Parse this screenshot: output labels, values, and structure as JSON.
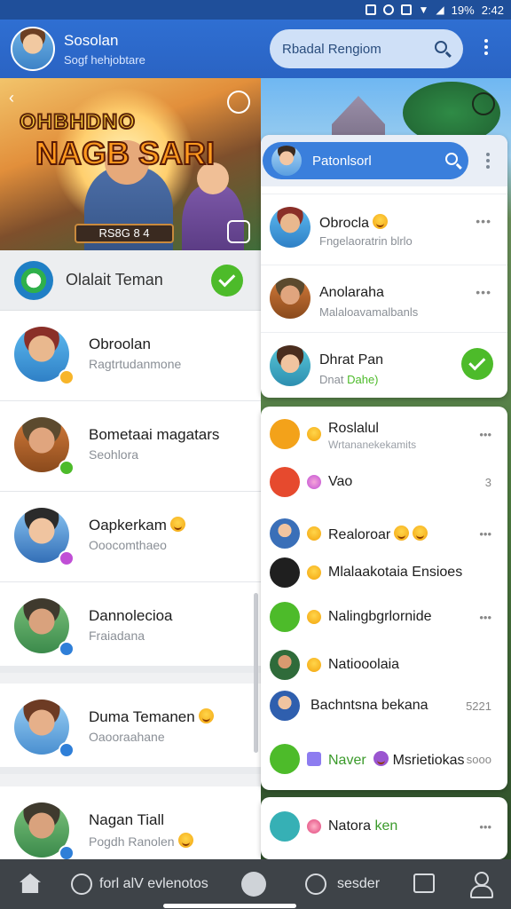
{
  "status_bar": {
    "battery": "19%",
    "time": "2:42"
  },
  "header": {
    "user_name": "Sosolan",
    "user_status": "Sogf hehjobtare",
    "search_label": "Rbadal Rengiom"
  },
  "hero": {
    "logo_top": "OHBHDNO",
    "logo_bottom": "NAGB SARI",
    "banner": "RS8G 8 4"
  },
  "online": {
    "label": "Olalait Teman"
  },
  "chats": [
    {
      "name": "Obroolan",
      "msg": "Ragtrtudanmone",
      "emoji": false
    },
    {
      "name": "Bometaai magatars",
      "msg": "Seohlora",
      "emoji": false
    },
    {
      "name": "Oapkerkam",
      "msg": "Ooocomthaeo",
      "emoji": true
    },
    {
      "name": "Dannolecioa",
      "msg": "Fraiadana",
      "emoji": false
    },
    {
      "name": "Duma Temanen",
      "msg": "Oaooraahane",
      "emoji": true
    },
    {
      "name": "Nagan Tiall",
      "msg": "Pogdh Ranolen",
      "emoji": true
    }
  ],
  "panel1": {
    "search_label": "Patonlsorl",
    "rows": [
      {
        "name": "Obrocla",
        "msg": "Fngelaoratrin blrlo",
        "meta": "•••"
      },
      {
        "name": "Anolaraha",
        "msg": "Malaloavamalbanls",
        "meta": "•••"
      },
      {
        "name": "Dhrat Pan",
        "msg": "Dnat",
        "msg_accent": "Dahe)",
        "meta": ""
      }
    ]
  },
  "panel2": [
    {
      "label": "Roslalul",
      "sub": "Wrtananekekamits",
      "meta": "•••"
    },
    {
      "label": "Vao",
      "sub": "",
      "meta": "3"
    },
    {
      "label": "Realoroar",
      "sub": "",
      "meta": "•••"
    },
    {
      "label": "Mlalaakotaia Ensioes",
      "sub": "",
      "meta": ""
    },
    {
      "label": "Nalingbgrlornide",
      "sub": "",
      "meta": "•••"
    },
    {
      "label": "Natiooolaia",
      "sub": "",
      "meta": ""
    },
    {
      "label": "Bachntsna bekana",
      "sub": "",
      "meta": "5221"
    },
    {
      "label": "Naver",
      "label2": "Msrietiokas",
      "meta": "sooo"
    }
  ],
  "panel3": {
    "label": "Natora",
    "accent": "ken",
    "meta": "•••"
  },
  "bottom_nav": {
    "item2": "forl alV evlenotos",
    "item4": "sesder"
  },
  "colors": {
    "brand_blue": "#2f6fd2",
    "accent_green": "#4dbb2a",
    "nav_bg": "#3e4348"
  }
}
